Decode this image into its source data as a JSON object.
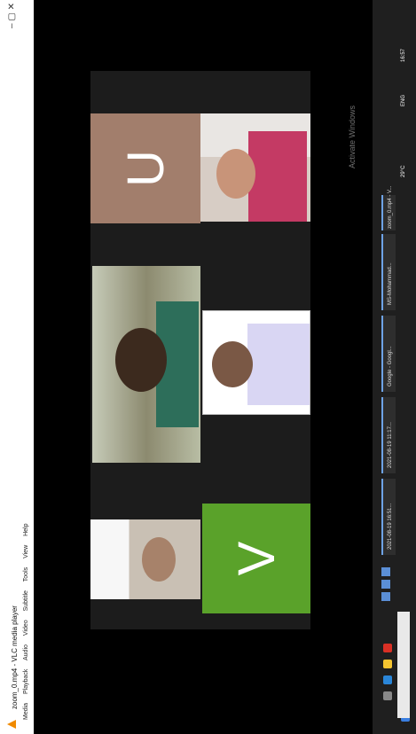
{
  "window": {
    "title": "zoom_0.mp4 - VLC media player",
    "controls": "–  ▢  ✕",
    "menu": [
      "Media",
      "Playback",
      "Audio",
      "Video",
      "Subtitle",
      "Tools",
      "View",
      "Help"
    ]
  },
  "participants": {
    "v_tile_letter": "V",
    "u_tile_letter": "U",
    "v_tile_color": "#5aa22a",
    "u_tile_color": "#a27e6c"
  },
  "watermark": "Activate Windows",
  "taskbar": {
    "items": [
      "2021-08-19 16:51...",
      "2021-08-19 11:17...",
      "Google - Googl...",
      "MS-Mohammad...",
      "zoom_0.mp4 - V..."
    ],
    "temperature": "29°C",
    "language": "ENG",
    "time": "16:57"
  }
}
